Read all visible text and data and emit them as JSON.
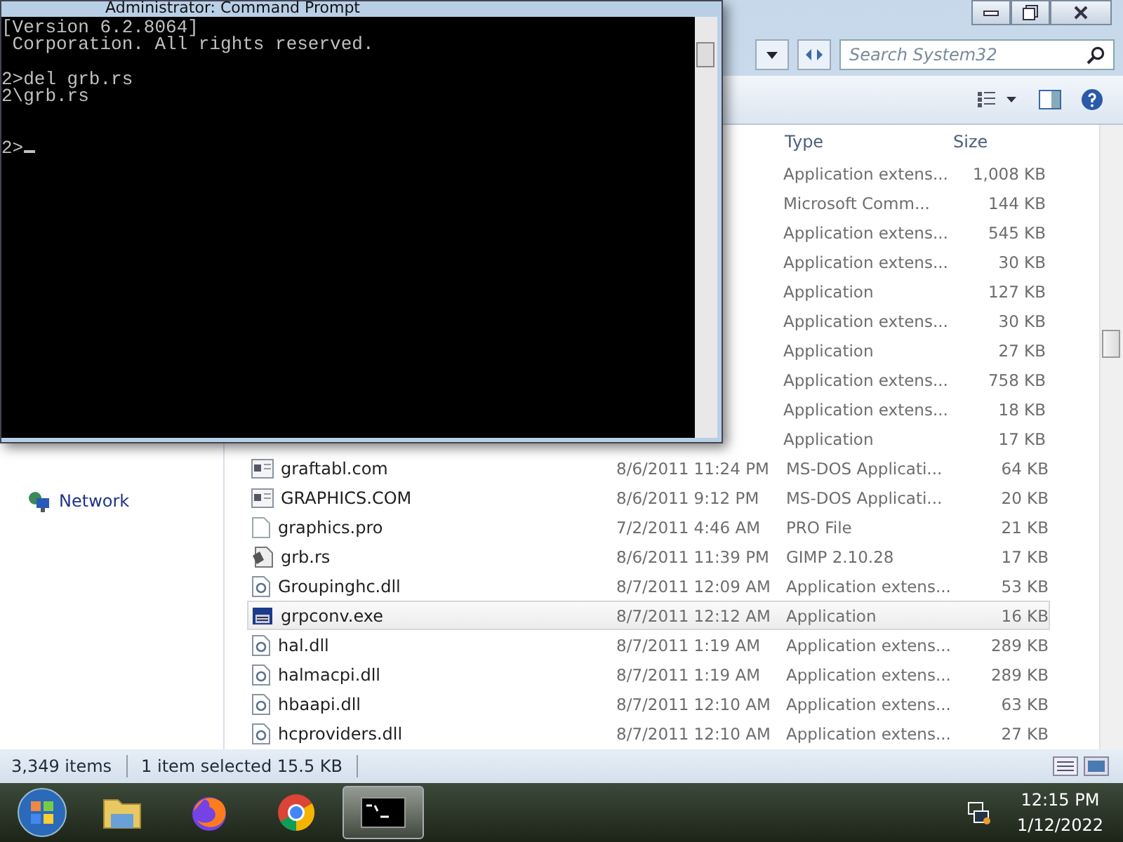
{
  "command_prompt": {
    "title": "Administrator: Command Prompt",
    "output": "[Version 6.2.8064]\n Corporation. All rights reserved.\n\n2>del grb.rs\n2\\grb.rs\n\n\n2>"
  },
  "explorer": {
    "search": {
      "placeholder": "Search System32"
    },
    "sidebar": {
      "items": [
        {
          "label": "Network",
          "kind": "network"
        }
      ]
    },
    "columns": [
      "Type",
      "Size"
    ],
    "rows": [
      {
        "type": "Application extens...",
        "size": "1,008 KB",
        "selected": false
      },
      {
        "type": "Microsoft Comm...",
        "size": "144 KB",
        "selected": false
      },
      {
        "type": "Application extens...",
        "size": "545 KB",
        "selected": false
      },
      {
        "type": "Application extens...",
        "size": "30 KB",
        "selected": false
      },
      {
        "type": "Application",
        "size": "127 KB",
        "selected": false
      },
      {
        "type": "Application extens...",
        "size": "30 KB",
        "selected": false
      },
      {
        "type": "Application",
        "size": "27 KB",
        "selected": false
      },
      {
        "type": "Application extens...",
        "size": "758 KB",
        "selected": false
      },
      {
        "type": "Application extens...",
        "size": "18 KB",
        "selected": false
      },
      {
        "type": "Application",
        "size": "17 KB",
        "selected": false
      },
      {
        "kind": "com",
        "name": "graftabl.com",
        "date": "8/6/2011 11:24 PM",
        "type": "MS-DOS Applicati...",
        "size": "64 KB",
        "selected": false
      },
      {
        "kind": "com",
        "name": "GRAPHICS.COM",
        "date": "8/6/2011 9:12 PM",
        "type": "MS-DOS Applicati...",
        "size": "20 KB",
        "selected": false
      },
      {
        "kind": "file",
        "name": "graphics.pro",
        "date": "7/2/2011 4:46 AM",
        "type": "PRO File",
        "size": "21 KB",
        "selected": false
      },
      {
        "kind": "image",
        "name": "grb.rs",
        "date": "8/6/2011 11:39 PM",
        "type": "GIMP 2.10.28",
        "size": "17 KB",
        "selected": false
      },
      {
        "kind": "dll",
        "name": "Groupinghc.dll",
        "date": "8/7/2011 12:09 AM",
        "type": "Application extens...",
        "size": "53 KB",
        "selected": false
      },
      {
        "kind": "exe",
        "name": "grpconv.exe",
        "date": "8/7/2011 12:12 AM",
        "type": "Application",
        "size": "16 KB",
        "selected": true
      },
      {
        "kind": "dll",
        "name": "hal.dll",
        "date": "8/7/2011 1:19 AM",
        "type": "Application extens...",
        "size": "289 KB",
        "selected": false
      },
      {
        "kind": "dll",
        "name": "halmacpi.dll",
        "date": "8/7/2011 1:19 AM",
        "type": "Application extens...",
        "size": "289 KB",
        "selected": false
      },
      {
        "kind": "dll",
        "name": "hbaapi.dll",
        "date": "8/7/2011 12:10 AM",
        "type": "Application extens...",
        "size": "63 KB",
        "selected": false
      },
      {
        "kind": "dll",
        "name": "hcproviders.dll",
        "date": "8/7/2011 12:10 AM",
        "type": "Application extens...",
        "size": "27 KB",
        "selected": false
      }
    ],
    "status_bar": {
      "count": "3,349 items",
      "selection": "1 item selected 15.5 KB"
    }
  },
  "taskbar": {
    "apps": [
      {
        "kind": "explorer",
        "active": false
      },
      {
        "kind": "firefox",
        "active": false
      },
      {
        "kind": "chrome",
        "active": false
      },
      {
        "kind": "terminal",
        "active": true
      }
    ],
    "clock": {
      "time": "12:15 PM",
      "date": "1/12/2022"
    }
  }
}
